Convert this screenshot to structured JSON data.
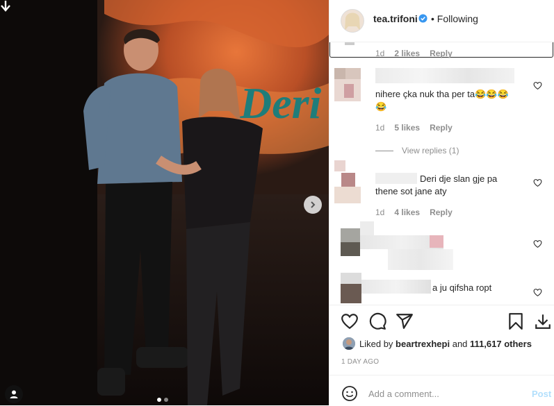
{
  "post": {
    "username": "tea.trifoni",
    "following_label": "Following",
    "separator": "•",
    "image_sign_text": "Deri"
  },
  "comments": [
    {
      "time": "1d",
      "likes": "2 likes",
      "reply": "Reply"
    },
    {
      "text": "nihere çka nuk tha per ta😂😂😂😂",
      "time": "1d",
      "likes": "5 likes",
      "reply": "Reply",
      "view_replies": "View replies (1)"
    },
    {
      "text": "Deri dje slan gje pa thene sot jane aty",
      "time": "1d",
      "likes": "4 likes",
      "reply": "Reply"
    },
    {
      "text": ""
    },
    {
      "text": "a ju qifsha ropt"
    }
  ],
  "likes": {
    "prefix": "Liked by",
    "user": "beartrexhepi",
    "and": "and",
    "count": "111,617 others"
  },
  "date": "1 DAY AGO",
  "add_comment": {
    "placeholder": "Add a comment...",
    "post_label": "Post"
  },
  "carousel": {
    "current": 1,
    "total": 2
  },
  "colors": {
    "verified": "#3897f0",
    "post_disabled": "#b2dffc",
    "meta_gray": "#8e8e8e"
  },
  "icons": [
    "down-arrow-icon",
    "chevron-right-icon",
    "user-tag-icon",
    "verified-icon",
    "heart-icon",
    "comment-icon",
    "share-icon",
    "bookmark-icon",
    "download-icon",
    "emoji-icon"
  ]
}
